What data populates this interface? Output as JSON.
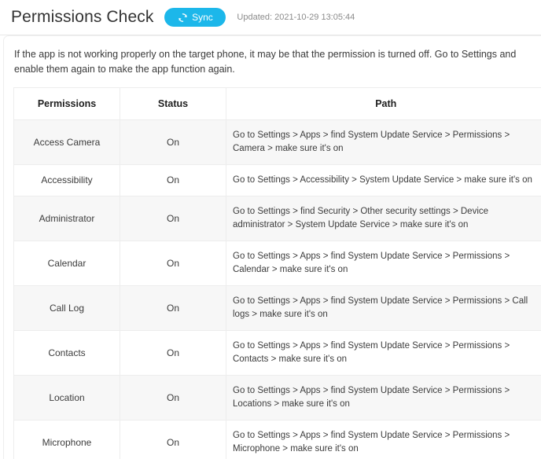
{
  "header": {
    "title": "Permissions Check",
    "sync_label": "Sync",
    "sync_icon": "sync-refresh-icon",
    "updated_text": "Updated: 2021-10-29 13:05:44",
    "accent_color": "#1cb7ea"
  },
  "notice": {
    "text": "If the app is not working properly on the target phone, it may be that the permission is turned off. Go to Settings and enable them again to make the app function again."
  },
  "table": {
    "columns": [
      "Permissions",
      "Status",
      "Path"
    ],
    "rows": [
      {
        "permission": "Access Camera",
        "status": "On",
        "path": "Go to Settings > Apps > find System Update Service > Permissions > Camera > make sure it's on"
      },
      {
        "permission": "Accessibility",
        "status": "On",
        "path": "Go to Settings > Accessibility > System Update Service > make sure it's on"
      },
      {
        "permission": "Administrator",
        "status": "On",
        "path": "Go to Settings > find Security > Other security settings > Device administrator > System Update Service > make sure it's on"
      },
      {
        "permission": "Calendar",
        "status": "On",
        "path": "Go to Settings > Apps > find System Update Service > Permissions > Calendar > make sure it's on"
      },
      {
        "permission": "Call Log",
        "status": "On",
        "path": "Go to Settings > Apps > find System Update Service > Permissions > Call logs > make sure it's on"
      },
      {
        "permission": "Contacts",
        "status": "On",
        "path": "Go to Settings > Apps > find System Update Service > Permissions > Contacts > make sure it's on"
      },
      {
        "permission": "Location",
        "status": "On",
        "path": "Go to Settings > Apps > find System Update Service > Permissions > Locations > make sure it's on"
      },
      {
        "permission": "Microphone",
        "status": "On",
        "path": "Go to Settings > Apps > find System Update Service > Permissions > Microphone > make sure it's on"
      }
    ]
  }
}
